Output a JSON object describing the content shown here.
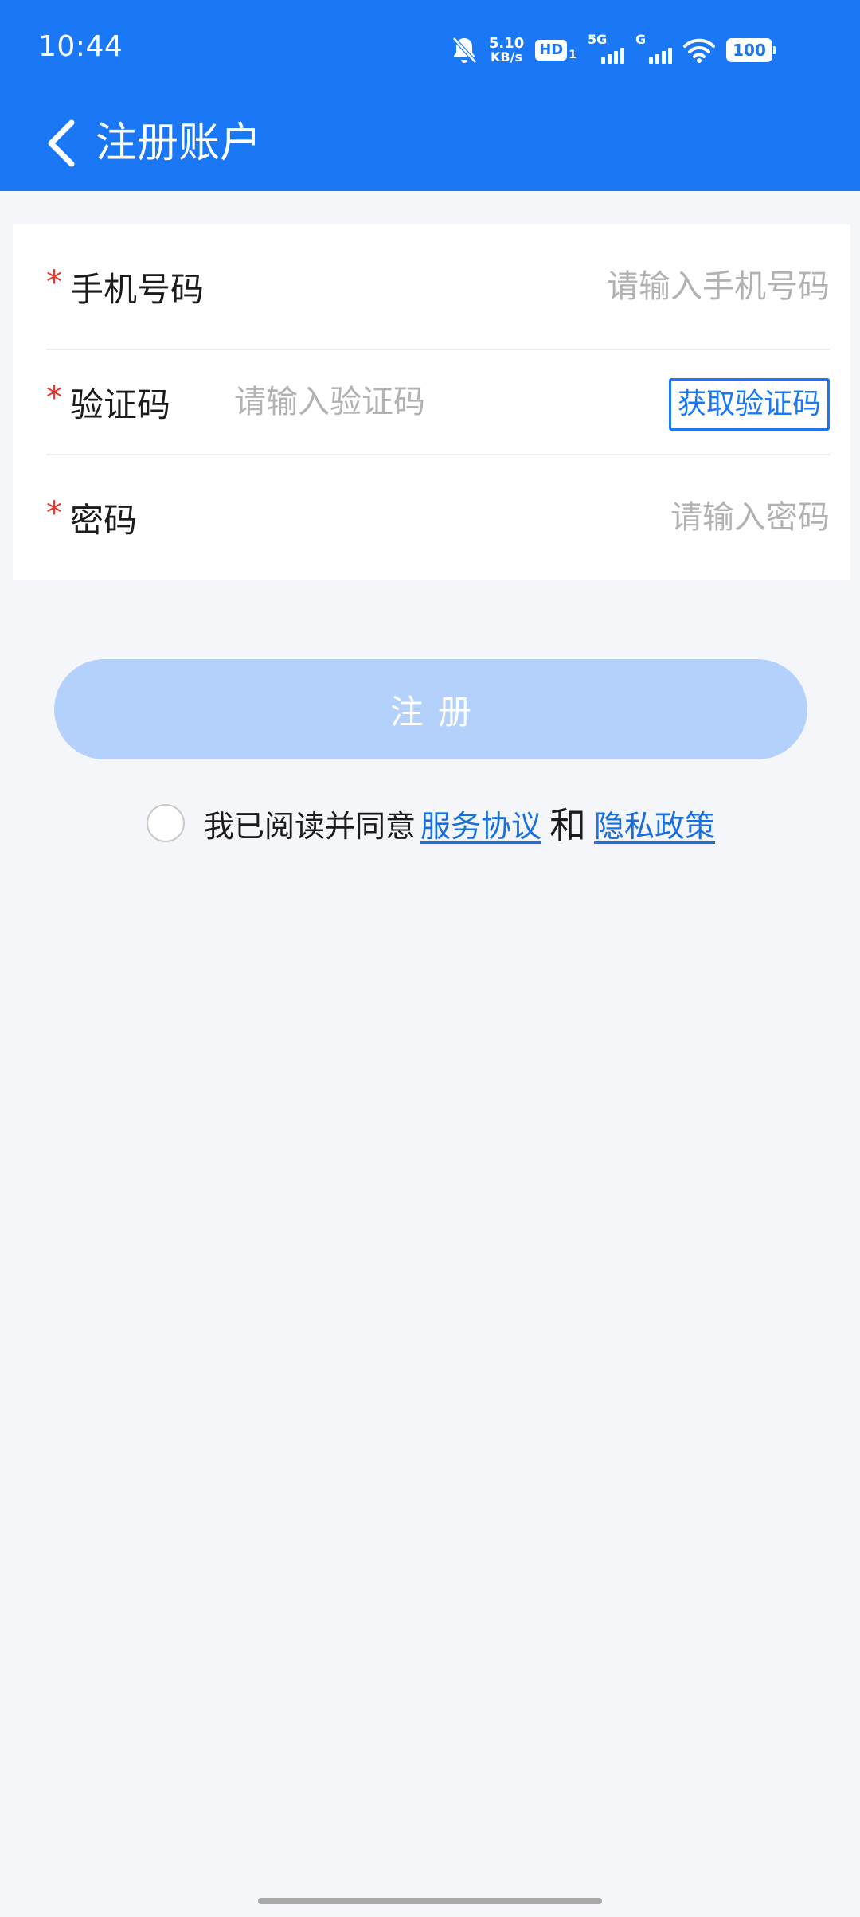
{
  "status_bar": {
    "time": "10:44",
    "net_speed_value": "5.10",
    "net_speed_unit": "KB/s",
    "hd_label": "HD",
    "hd_sub": "1",
    "signal_1_tag": "5G",
    "signal_2_tag": "G",
    "battery": "100",
    "icons": [
      "bell-off-icon",
      "hd-icon",
      "signal-icon",
      "wifi-icon",
      "battery-icon"
    ]
  },
  "nav": {
    "back_icon": "chevron-left-icon",
    "title": "注册账户"
  },
  "form": {
    "phone": {
      "required": "*",
      "label": "手机号码",
      "placeholder": "请输入手机号码",
      "value": ""
    },
    "code": {
      "required": "*",
      "label": "验证码",
      "placeholder": "请输入验证码",
      "value": "",
      "button_label": "获取验证码"
    },
    "password": {
      "required": "*",
      "label": "密码",
      "placeholder": "请输入密码",
      "value": ""
    }
  },
  "register_button": {
    "label": "注册"
  },
  "agreement": {
    "checked": false,
    "prefix": "我已阅读并同意",
    "service_link": "服务协议",
    "conjunction": "和",
    "privacy_link": "隐私政策"
  },
  "colors": {
    "brand_blue": "#1a78f7",
    "disabled_button": "#b3d1fb",
    "required_red": "#e23b2e",
    "page_background": "#f4f6fa"
  }
}
